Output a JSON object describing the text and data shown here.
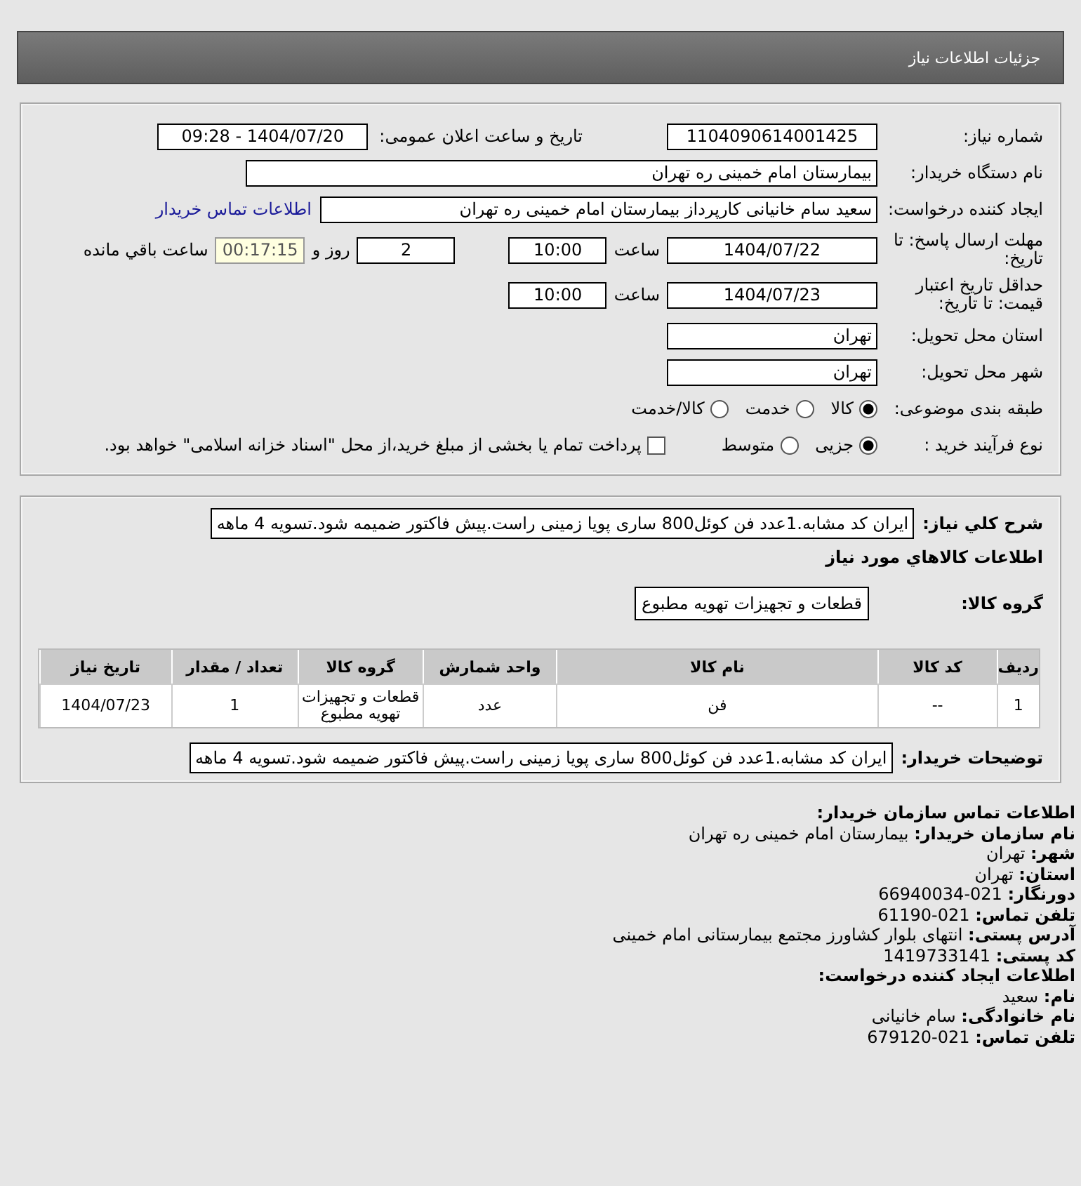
{
  "header": {
    "title": "جزئیات اطلاعات نیاز"
  },
  "details": [
    {
      "kind": "pair",
      "label": "شماره نیاز:",
      "value": "1104090614001425",
      "label2": "تاریخ و ساعت اعلان عمومی:",
      "value2": "1404/07/20 - 09:28"
    },
    {
      "kind": "wide",
      "label": "نام دستگاه خریدار:",
      "value": "بیمارستان امام خمینی ره  تهران"
    },
    {
      "kind": "link",
      "label": "ایجاد کننده درخواست:",
      "value": "سعید سام خانیانی کارپرداز بیمارستان امام خمینی ره  تهران",
      "link": "اطلاعات تماس خریدار"
    },
    {
      "kind": "deadline",
      "label": "مهلت ارسال پاسخ: تا تاریخ:",
      "date": "1404/07/22",
      "time_label": "ساعت",
      "time": "10:00",
      "days": "2",
      "days_label": "روز و",
      "remaining": "00:17:15",
      "remaining_label": "ساعت باقي مانده"
    },
    {
      "kind": "deadline",
      "label": "حداقل تاریخ اعتبار قیمت: تا تاریخ:",
      "date": "1404/07/23",
      "time_label": "ساعت",
      "time": "10:00"
    },
    {
      "kind": "field",
      "label": "استان محل تحویل:",
      "value": "تهران"
    },
    {
      "kind": "field",
      "label": "شهر محل تحویل:",
      "value": "تهران"
    },
    {
      "kind": "radios",
      "label": "طبقه بندی موضوعی:",
      "options": [
        {
          "label": "کالا",
          "selected": true
        },
        {
          "label": "خدمت",
          "selected": false
        },
        {
          "label": "کالا/خدمت",
          "selected": false
        }
      ]
    },
    {
      "kind": "radios",
      "label": "نوع فرآیند خرید :",
      "options": [
        {
          "label": "جزیی",
          "selected": true
        },
        {
          "label": "متوسط",
          "selected": false
        }
      ],
      "checkbox": {
        "label": "پرداخت تمام یا بخشی از مبلغ خرید،از محل \"اسناد خزانه اسلامی\" خواهد بود.",
        "checked": false
      }
    }
  ],
  "needs": {
    "summary_label": "شرح کلي نیاز:",
    "summary": "ایران کد مشابه.1عدد فن کوئل800 ساری پویا زمینی راست.پیش فاکتور ضمیمه شود.تسویه 4 ماهه",
    "goods_heading": "اطلاعات کالاهاي مورد نیاز",
    "group_label": "گروه کالا:",
    "group": "قطعات و تجهیزات تهویه مطبوع",
    "table": {
      "columns": [
        "ردیف",
        "کد کالا",
        "نام کالا",
        "واحد شمارش",
        "گروه کالا",
        "تعداد / مقدار",
        "تاریخ نیاز"
      ],
      "rows": [
        [
          "1",
          "--",
          "فن",
          "عدد",
          "قطعات و تجهیزات تهویه مطبوع",
          "1",
          "1404/07/23"
        ]
      ]
    },
    "notes_label": "توضیحات خریدار:",
    "notes": "ایران کد مشابه.1عدد فن کوئل800 ساری پویا زمینی راست.پیش فاکتور ضمیمه شود.تسویه 4 ماهه"
  },
  "contact": [
    {
      "kind": "heading",
      "text": "اطلاعات تماس سازمان خریدار:"
    },
    {
      "kind": "line",
      "text": "**نام سازمان خریدار:** بیمارستان امام خمینی ره تهران"
    },
    {
      "kind": "line",
      "text": "**شهر:** تهران"
    },
    {
      "kind": "line",
      "text": "**استان:** تهران"
    },
    {
      "kind": "line",
      "text": "**دورنگار:** 021-66940034"
    },
    {
      "kind": "line",
      "text": "**تلفن تماس:** 021-61190"
    },
    {
      "kind": "line",
      "text": "**آدرس پستی:** انتهای بلوار کشاورز مجتمع بیمارستانی امام خمینی"
    },
    {
      "kind": "line",
      "text": "**کد پستی:** 1419733141"
    },
    {
      "kind": "heading",
      "text": "اطلاعات ایجاد کننده درخواست:"
    },
    {
      "kind": "line",
      "text": "**نام:** سعید"
    },
    {
      "kind": "line",
      "text": "**نام خانوادگی:** سام خانیانی"
    },
    {
      "kind": "line",
      "text": "**تلفن تماس:** 021-679120"
    }
  ]
}
